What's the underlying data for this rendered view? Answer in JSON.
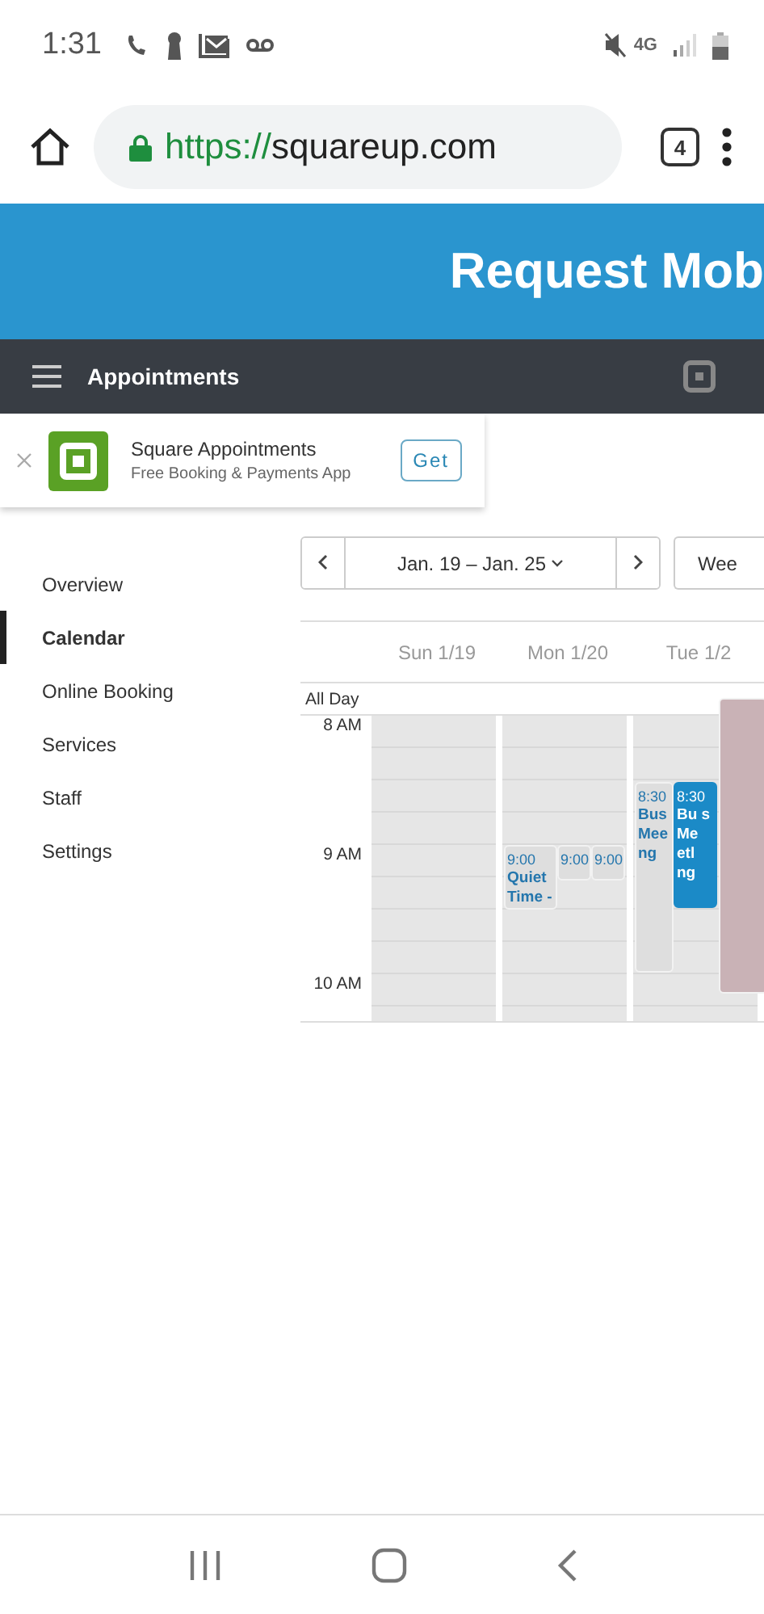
{
  "status_bar": {
    "time": "1:31",
    "network": "4G"
  },
  "browser": {
    "scheme": "https://",
    "host": "squareup.com",
    "tab_count": "4"
  },
  "header": {
    "title": "Request Mob"
  },
  "nav": {
    "title": "Appointments"
  },
  "app_banner": {
    "name": "Square Appointments",
    "subtitle": "Free Booking & Payments App",
    "button": "Get"
  },
  "sidebar": {
    "items": [
      {
        "label": "Overview",
        "selected": false
      },
      {
        "label": "Calendar",
        "selected": true
      },
      {
        "label": "Online Booking",
        "selected": false
      },
      {
        "label": "Services",
        "selected": false
      },
      {
        "label": "Staff",
        "selected": false
      },
      {
        "label": "Settings",
        "selected": false
      }
    ]
  },
  "calendar": {
    "range": "Jan. 19 – Jan. 25",
    "view": "Wee",
    "all_day": "All Day",
    "hours": [
      "8 AM",
      "9 AM",
      "10 AM"
    ],
    "days": [
      {
        "label": "Sun 1/19"
      },
      {
        "label": "Mon 1/20",
        "events": [
          {
            "kind": "light",
            "time": "9:00",
            "title": "Quiet Time -"
          },
          {
            "kind": "light",
            "time": "9:00"
          },
          {
            "kind": "light",
            "time": "9:00"
          }
        ]
      },
      {
        "label": "Tue 1/2",
        "events": [
          {
            "kind": "light",
            "time": "8:30",
            "title": "Bus Mee ng"
          },
          {
            "kind": "solid",
            "time": "8:30",
            "title": "Bu s Me etl ng"
          },
          {
            "kind": "blocked"
          }
        ]
      }
    ]
  }
}
